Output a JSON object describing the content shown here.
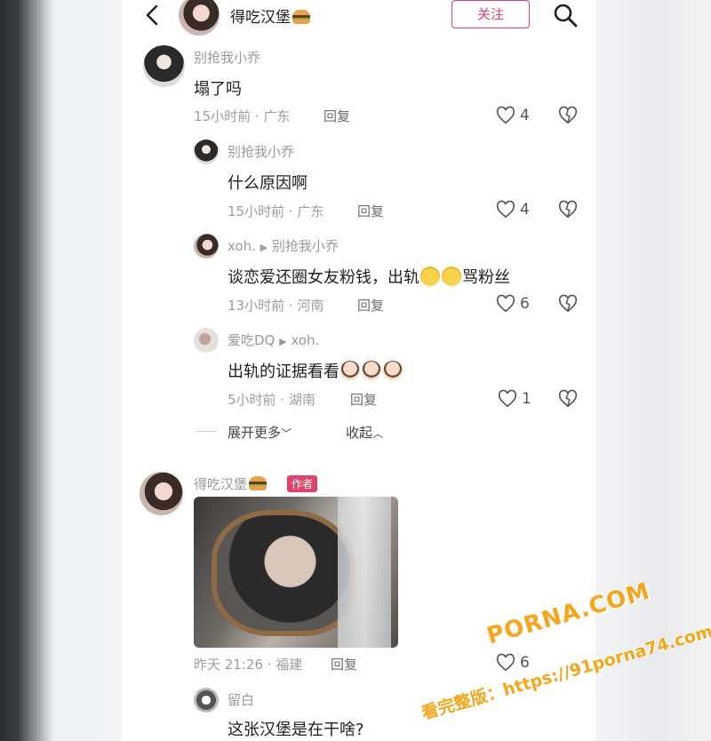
{
  "header": {
    "title": "得吃汉堡",
    "follow_label": "关注"
  },
  "comments": [
    {
      "user": "别抢我小乔",
      "text": "塌了吗",
      "meta": "15小时前 · 广东",
      "reply": "回复",
      "likes": "4"
    },
    {
      "user": "别抢我小乔",
      "text": "什么原因啊",
      "meta": "15小时前 · 广东",
      "reply": "回复",
      "likes": "4"
    },
    {
      "user": "xoh.",
      "reply_to": "别抢我小乔",
      "text_a": "谈恋爱还圈女友粉钱，出轨",
      "text_b": "骂粉丝",
      "meta": "13小时前 · 河南",
      "reply": "回复",
      "likes": "6"
    },
    {
      "user": "爱吃DQ",
      "reply_to": "xoh.",
      "text": "出轨的证据看看",
      "meta": "5小时前 · 湖南",
      "reply": "回复",
      "likes": "1"
    },
    {
      "user": "得吃汉堡",
      "badge": "作者",
      "meta": "昨天 21:26 · 福建",
      "reply": "回复",
      "likes": "6"
    },
    {
      "user": "留白",
      "text": "这张汉堡是在干啥?"
    }
  ],
  "thread_controls": {
    "expand": "展开更多",
    "collapse": "收起"
  },
  "watermark": {
    "line1": "PORNA.COM",
    "line2": "看完整版：https://91porna74.com"
  },
  "icons": [
    "back-icon",
    "search-icon",
    "heart-icon",
    "broken-heart-icon",
    "chevron-down-icon",
    "chevron-up-icon",
    "burger-emoji",
    "crying-emoji",
    "peeking-face-emoji"
  ],
  "colors": {
    "accent": "#e0436a",
    "watermark": "#f7a51b"
  }
}
